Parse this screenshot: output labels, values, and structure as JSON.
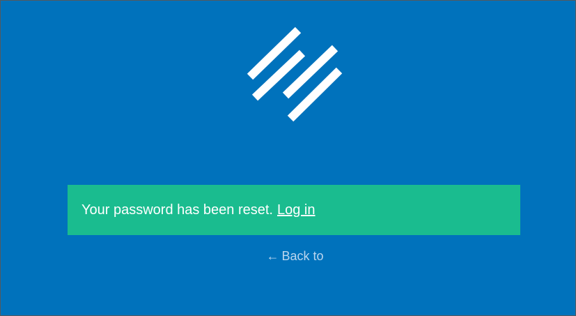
{
  "brand": {
    "logo_icon": "diagonal-stripes-logo-icon",
    "colors": {
      "background": "#0072bc",
      "notice": "#1abc8f",
      "text": "#ffffff",
      "link_muted": "#bcd6ef"
    }
  },
  "notice": {
    "message": "Your password has been reset.",
    "login_link": "Log in"
  },
  "back_link": {
    "arrow": "←",
    "label": "Back to"
  }
}
